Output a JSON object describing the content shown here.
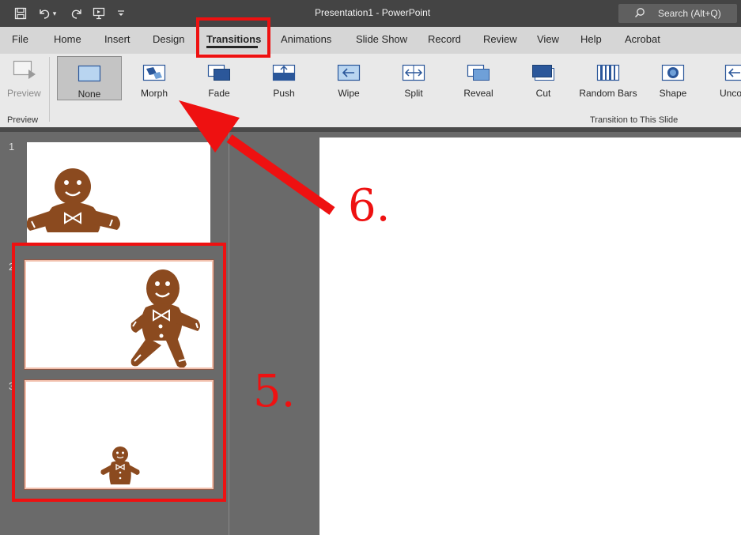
{
  "window": {
    "title": "Presentation1  -  PowerPoint"
  },
  "search": {
    "label": "Search (Alt+Q)"
  },
  "quick_access": {
    "icons": [
      "save-icon",
      "undo-icon",
      "redo-icon",
      "present-icon",
      "customize-icon"
    ]
  },
  "tabs": [
    "File",
    "Home",
    "Insert",
    "Design",
    "Transitions",
    "Animations",
    "Slide Show",
    "Record",
    "Review",
    "View",
    "Help",
    "Acrobat"
  ],
  "active_tab": "Transitions",
  "ribbon": {
    "preview_label": "Preview",
    "preview_group_label": "Preview",
    "transitions_group_label": "Transition to This Slide",
    "transitions": [
      "None",
      "Morph",
      "Fade",
      "Push",
      "Wipe",
      "Split",
      "Reveal",
      "Cut",
      "Random Bars",
      "Shape",
      "Unco"
    ],
    "selected_transition": "None"
  },
  "slides": [
    {
      "number": "1",
      "content": "gingerbread-man-image"
    },
    {
      "number": "2",
      "content": "gingerbread-man-walking-image"
    },
    {
      "number": "3",
      "content": "gingerbread-man-small-image"
    }
  ],
  "annotations": {
    "step5": "5.",
    "step6": "6."
  },
  "colors": {
    "annotation": "#ee1111",
    "title_bar": "#444444",
    "ribbon": "#e9e9e9",
    "tabs_bar": "#d6d6d6",
    "selected_thumb": "#f2c0ad"
  }
}
